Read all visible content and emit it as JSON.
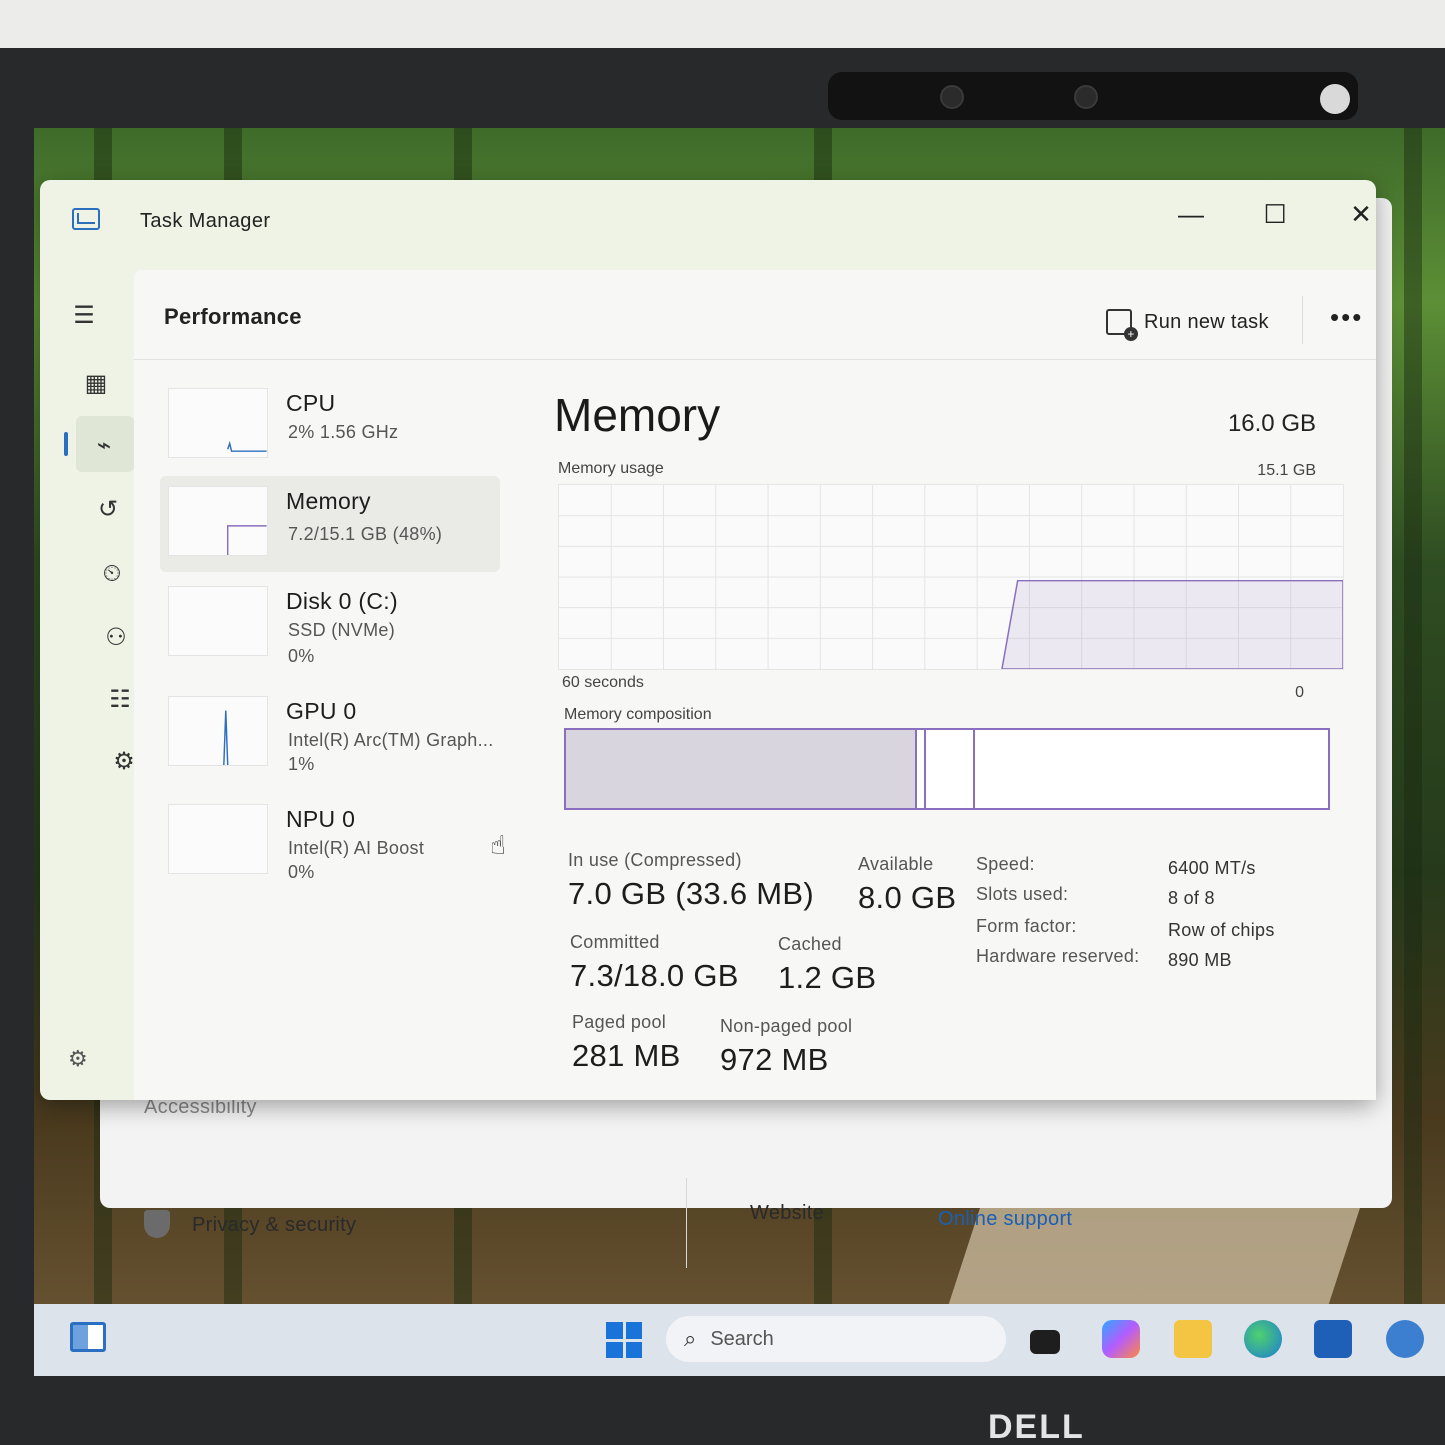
{
  "window": {
    "title": "Task Manager",
    "minimize": "—",
    "maximize": "☐",
    "close": "✕"
  },
  "header": {
    "page_title": "Performance",
    "run_new_task": "Run new task",
    "more": "•••"
  },
  "perf_items": [
    {
      "name": "CPU",
      "line1": "2%  1.56 GHz",
      "line2": ""
    },
    {
      "name": "Memory",
      "line1": "7.2/15.1 GB (48%)",
      "line2": ""
    },
    {
      "name": "Disk 0 (C:)",
      "line1": "SSD (NVMe)",
      "line2": "0%"
    },
    {
      "name": "GPU 0",
      "line1": "Intel(R) Arc(TM) Graph...",
      "line2": "1%"
    },
    {
      "name": "NPU 0",
      "line1": "Intel(R) AI Boost",
      "line2": "0%"
    }
  ],
  "memory": {
    "title": "Memory",
    "total": "16.0 GB",
    "usage_label": "Memory usage",
    "usage_max": "15.1 GB",
    "axis_left": "60 seconds",
    "axis_right": "0",
    "composition_label": "Memory composition",
    "composition": {
      "in_use_fraction": 0.46,
      "modified_fraction": 0.012,
      "standby_fraction": 0.065
    },
    "usage_level_fraction": 0.48,
    "stats": {
      "in_use_label": "In use (Compressed)",
      "in_use_value": "7.0 GB (33.6 MB)",
      "available_label": "Available",
      "available_value": "8.0 GB",
      "committed_label": "Committed",
      "committed_value": "7.3/18.0 GB",
      "cached_label": "Cached",
      "cached_value": "1.2 GB",
      "paged_label": "Paged pool",
      "paged_value": "281 MB",
      "nonpaged_label": "Non-paged pool",
      "nonpaged_value": "972 MB"
    },
    "specs": [
      {
        "label": "Speed:",
        "value": "6400 MT/s"
      },
      {
        "label": "Slots used:",
        "value": "8 of 8"
      },
      {
        "label": "Form factor:",
        "value": "Row of chips"
      },
      {
        "label": "Hardware reserved:",
        "value": "890 MB"
      }
    ]
  },
  "settings_background": {
    "accessibility": "Accessibility",
    "privacy": "Privacy & security",
    "website": "Website",
    "online_support": "Online support",
    "close": "✕"
  },
  "taskbar": {
    "search_placeholder": "Search"
  },
  "brand": "DELL",
  "colors": {
    "accent": "#2d6fbf",
    "memory_purple": "#8a6fc0"
  }
}
